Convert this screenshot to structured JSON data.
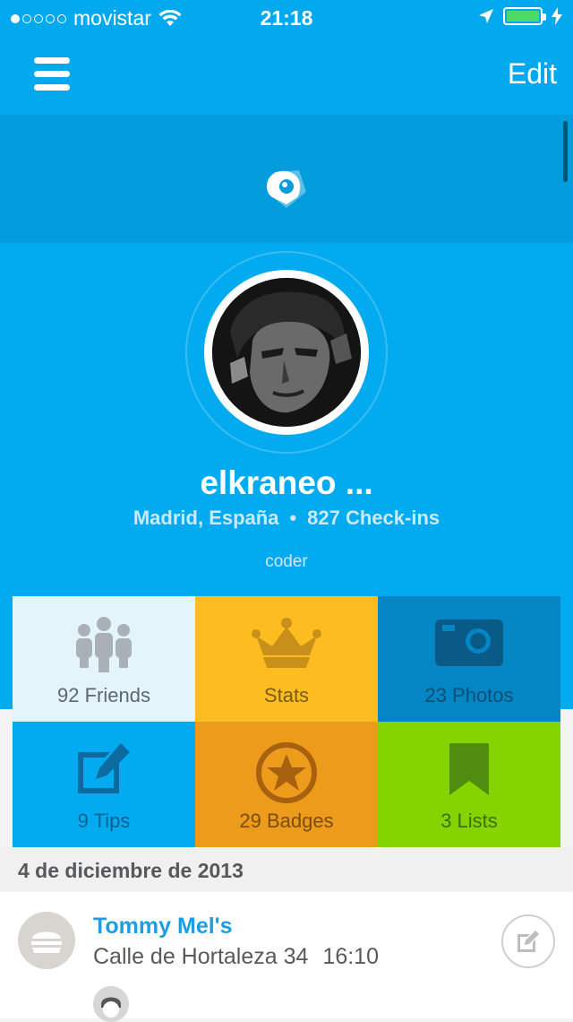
{
  "status_bar": {
    "carrier": "movistar",
    "time": "21:18",
    "signal_dots_filled": 1,
    "signal_dots_total": 5,
    "battery_level": 1.0
  },
  "nav": {
    "menu_icon": "hamburger-icon",
    "edit_label": "Edit"
  },
  "header": {
    "logo_icon": "foursquare-eye-logo"
  },
  "profile": {
    "name": "elkraneo ...",
    "location": "Madrid, España",
    "separator": "•",
    "checkins": "827 Check-ins",
    "bio": "coder"
  },
  "tiles": [
    {
      "icon": "friends-icon",
      "label": "92 Friends",
      "color": "#e4f4fb"
    },
    {
      "icon": "crown-icon",
      "label": "Stats",
      "color": "#fdbd21"
    },
    {
      "icon": "camera-icon",
      "label": "23 Photos",
      "color": "#0486c4"
    },
    {
      "icon": "edit-icon",
      "label": "9 Tips",
      "color": "#02aaef"
    },
    {
      "icon": "star-badge-icon",
      "label": "29 Badges",
      "color": "#ec9b1a"
    },
    {
      "icon": "bookmark-icon",
      "label": "3 Lists",
      "color": "#84d400"
    }
  ],
  "feed": {
    "date": "4 de diciembre de 2013",
    "items": [
      {
        "venue": "Tommy Mel's",
        "address": "Calle de Hortaleza 34",
        "time": "16:10",
        "venue_icon": "burger-icon",
        "action_icon": "add-tip-icon"
      }
    ]
  },
  "colors": {
    "brand_blue": "#02a9ee",
    "header_blue": "#039ddd",
    "link_blue": "#1d9ee2"
  }
}
